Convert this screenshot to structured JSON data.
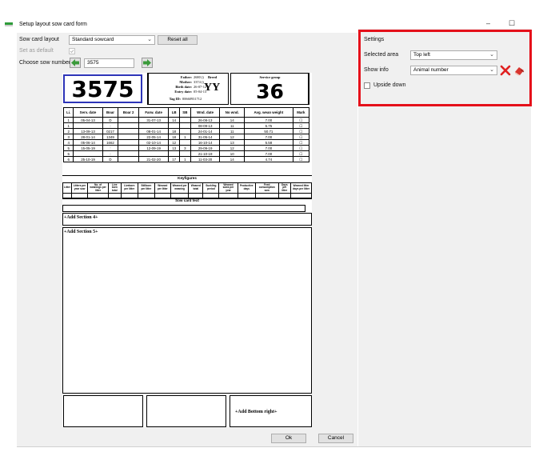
{
  "window": {
    "title": "Setup layout sow card form",
    "minimize_glyph": "–",
    "maximize_glyph": "☐"
  },
  "left": {
    "layout_label": "Sow card layout",
    "layout_value": "Standard sowcard",
    "reset_label": "Reset all",
    "default_label": "Set as default",
    "choose_label": "Choose sow number",
    "sow_number_value": "3575"
  },
  "card": {
    "sow_big": "3575",
    "father_label": "Father:",
    "father_value": "2680 ()",
    "mother_label": "Mother:",
    "mother_value": "3374 ()",
    "birth_label": "Birth date:",
    "birth_value": "26-07-12",
    "entry_label": "Entry date:",
    "entry_value": "05-04-13",
    "tag_label": "Tag ID:",
    "tag_value": "00660931712",
    "breed_label": "Breed",
    "breed_value": "YY",
    "group_label": "Service group",
    "group_value": "36",
    "table": {
      "headers": [
        "Li.",
        "Serv. date",
        "Boar",
        "Boar 2",
        "Farw. date",
        "LB",
        "SB",
        "Wnd. date",
        "No wnd.",
        "Avg. wean weight",
        "Mark"
      ],
      "rows": [
        [
          "1",
          "05-04-13",
          "D",
          "",
          "31-07-13",
          "14",
          "",
          "26-08-13",
          "14",
          "7.00",
          "☐"
        ],
        [
          "1",
          "",
          ":",
          "",
          "",
          "",
          "",
          "08-09-13",
          "11",
          "6.75",
          "☐"
        ],
        [
          "2",
          "13-09-13",
          "0217",
          "",
          "08-01-14",
          "18",
          "",
          "24-01-14",
          "11",
          "50.71",
          "☐"
        ],
        [
          "3",
          "28-01-14",
          "1349",
          "",
          "22-05-14",
          "18",
          "1",
          "31-05-14",
          "12",
          "7.00",
          "☐"
        ],
        [
          "4",
          "05-06-14",
          "1662",
          "",
          "02-10-14",
          "12",
          "",
          "16-10-14",
          "13",
          "5.58",
          "☐"
        ],
        [
          "5",
          "15-05-19",
          ":",
          "",
          "12-09-19",
          "13",
          "3",
          "29-09-19",
          "12",
          "7.00",
          "☐"
        ],
        [
          "5",
          "",
          ":",
          "",
          "",
          "",
          "",
          "21-10-19",
          "10",
          "7.00",
          "☐"
        ],
        [
          "6",
          "25-10-19",
          "D",
          "",
          "21-02-20",
          "17",
          "1",
          "11-03-20",
          "14",
          "4.74",
          "☐"
        ]
      ]
    },
    "keyfigures_title": "Keyfigures",
    "keyfigures_headers": [
      "Litter",
      "Litters per year sow",
      "No. of weanings per litter",
      "Live born total",
      "Liveborn per litter",
      "Stillborn per litter",
      "Weaned per litter",
      "Weaned per weaning",
      "Weaned total",
      "Suckling period",
      "Weaned sows per year",
      "Productive days",
      "Feed consumption sow",
      "Days per litter",
      "Weaned litter days per litter"
    ],
    "sowcard_text_title": "Sow card text",
    "add_section_4": "+Add Section 4+",
    "add_section_5": "+Add Section 5+",
    "add_bottom_right": "+Add Bottom right+"
  },
  "settings": {
    "title": "Settings",
    "area_label": "Selected area",
    "area_value": "Top left",
    "show_label": "Show info",
    "show_value": "Animal number",
    "upside_label": "Upside down"
  },
  "footer": {
    "ok_label": "Ok",
    "cancel_label": "Cancel"
  },
  "colors": {
    "highlight": "#e5101a",
    "sow_border": "#2d34b8",
    "arrow_green": "#3a9a3a"
  }
}
